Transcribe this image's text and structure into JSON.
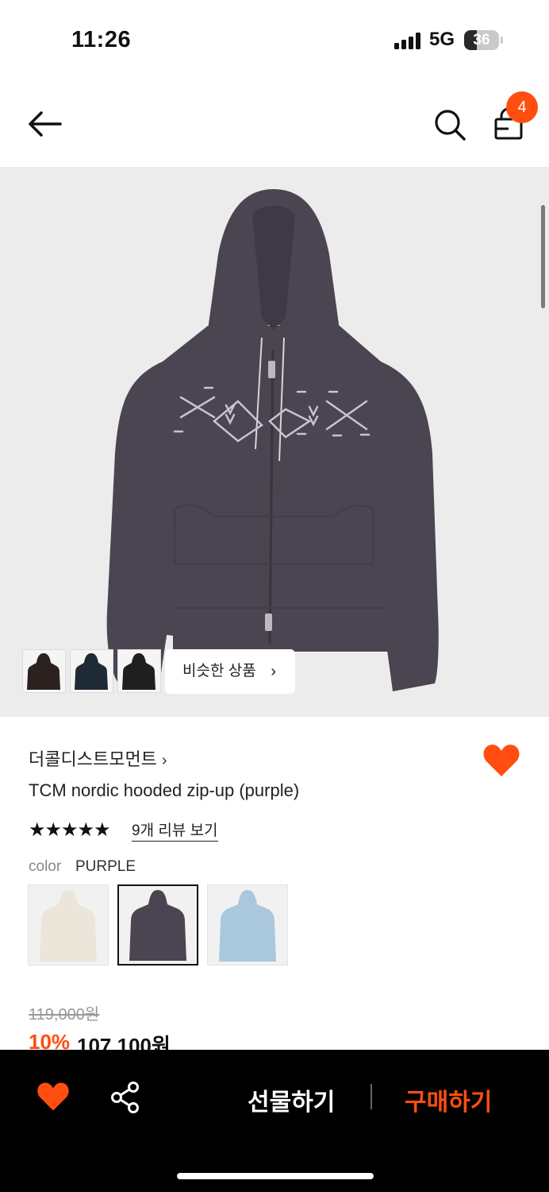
{
  "status_bar": {
    "time": "11:26",
    "network": "5G",
    "battery_level": "36"
  },
  "header": {
    "cart_count": "4",
    "back_icon": "arrow-left-icon",
    "search_icon": "search-icon",
    "bag_icon": "shopping-bag-icon"
  },
  "hero": {
    "similar_label": "비슷한 상품",
    "similar_chevron": "›",
    "thumb_colors": [
      "#2b2220",
      "#1e2a36",
      "#1f1f20"
    ],
    "hoodie_color": "#4b4451"
  },
  "product": {
    "brand": "더콜디스트모먼트",
    "brand_chevron": "›",
    "name": "TCM nordic hooded zip-up (purple)",
    "stars": "★★★★★",
    "rating": 5,
    "review_link": "9개 리뷰 보기",
    "color_label": "color",
    "color_value": "PURPLE",
    "swatches": [
      {
        "name": "ivory",
        "color": "#ece6da"
      },
      {
        "name": "purple",
        "color": "#4b4451",
        "selected": true
      },
      {
        "name": "sky blue",
        "color": "#a9c8de"
      }
    ],
    "original_price": "119,000원",
    "discount": "10%",
    "final_price": "107,100원"
  },
  "bottom_bar": {
    "gift_label": "선물하기",
    "buy_label": "구매하기",
    "heart_icon": "heart-icon",
    "share_icon": "share-icon"
  },
  "colors": {
    "accent": "#ff4e10"
  }
}
